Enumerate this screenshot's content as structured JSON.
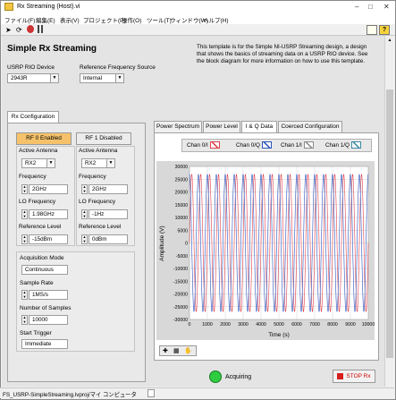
{
  "window": {
    "title": "Rx Streaming (Host).vi"
  },
  "menu": [
    "ファイル(F)",
    "編集(E)",
    "表示(V)",
    "プロジェクト(P)",
    "操作(O)",
    "ツール(T)",
    "ウィンドウ(W)",
    "ヘルプ(H)"
  ],
  "header": {
    "title": "Simple Rx Streaming",
    "description": "This template is for the Simple NI-USRP Streaming design, a design that shows the basics of streaming data on a USRP RIO device. See the block diagram for more information on how to use this template."
  },
  "device": {
    "label": "USRP RIO Device",
    "value": "2943R"
  },
  "ref_source": {
    "label": "Reference Frequency Source",
    "value": "Internal"
  },
  "rx_tab": "Rx Configuration",
  "rf0": {
    "button": "RF 0 Enabled",
    "antenna_label": "Active Antenna",
    "antenna": "RX2",
    "freq_label": "Frequency",
    "freq": "2GHz",
    "lo_label": "LO Frequency",
    "lo": "1.98GHz",
    "ref_label": "Reference Level",
    "ref": "-15dBm"
  },
  "rf1": {
    "button": "RF 1 Disabled",
    "antenna_label": "Active Antenna",
    "antenna": "RX2",
    "freq_label": "Frequency",
    "freq": "2GHz",
    "lo_label": "LO Frequency",
    "lo": "-1Hz",
    "ref_label": "Reference Level",
    "ref": "0dBm"
  },
  "acq": {
    "mode_label": "Acquisition Mode",
    "mode": "Continuous",
    "rate_label": "Sample Rate",
    "rate": "1MS/s",
    "samples_label": "Number of Samples",
    "samples": "10000",
    "trigger_label": "Start Trigger",
    "trigger": "Immediate"
  },
  "tabs": [
    "Power Spectrum",
    "Power Level",
    "I & Q Data",
    "Coerced Configuration"
  ],
  "legend": [
    "Chan 0/I",
    "Chan 0/Q",
    "Chan 1/I",
    "Chan 1/Q"
  ],
  "colors": {
    "chan0i": "#e0404a",
    "chan0q": "#2a52be",
    "stop_text": "#c00000",
    "acquiring_led": "#2ecc40"
  },
  "status": {
    "acquiring": "Acquiring",
    "stop": "STOP Rx"
  },
  "statusbar": {
    "path": "FS_USRP-SimpleStreaming.lvproj/マイ コンピュータ"
  },
  "chart_data": {
    "type": "line",
    "title": "",
    "xlabel": "Time (s)",
    "ylabel": "Amplitude (V)",
    "xlim": [
      0,
      10000
    ],
    "ylim": [
      -30000,
      30000
    ],
    "xticks": [
      0,
      1000,
      2000,
      3000,
      4000,
      5000,
      6000,
      7000,
      8000,
      9000,
      10000
    ],
    "yticks": [
      30000,
      25000,
      20000,
      15000,
      10000,
      5000,
      0,
      -5000,
      -10000,
      -15000,
      -20000,
      -25000,
      -30000
    ],
    "grid": true,
    "series": [
      {
        "name": "Chan 0/I",
        "color": "#e0404a",
        "amplitude": 27000,
        "cycles": 20,
        "phase": 0
      },
      {
        "name": "Chan 0/Q",
        "color": "#2a52be",
        "amplitude": 27000,
        "cycles": 20,
        "phase": 1.5708
      }
    ]
  }
}
